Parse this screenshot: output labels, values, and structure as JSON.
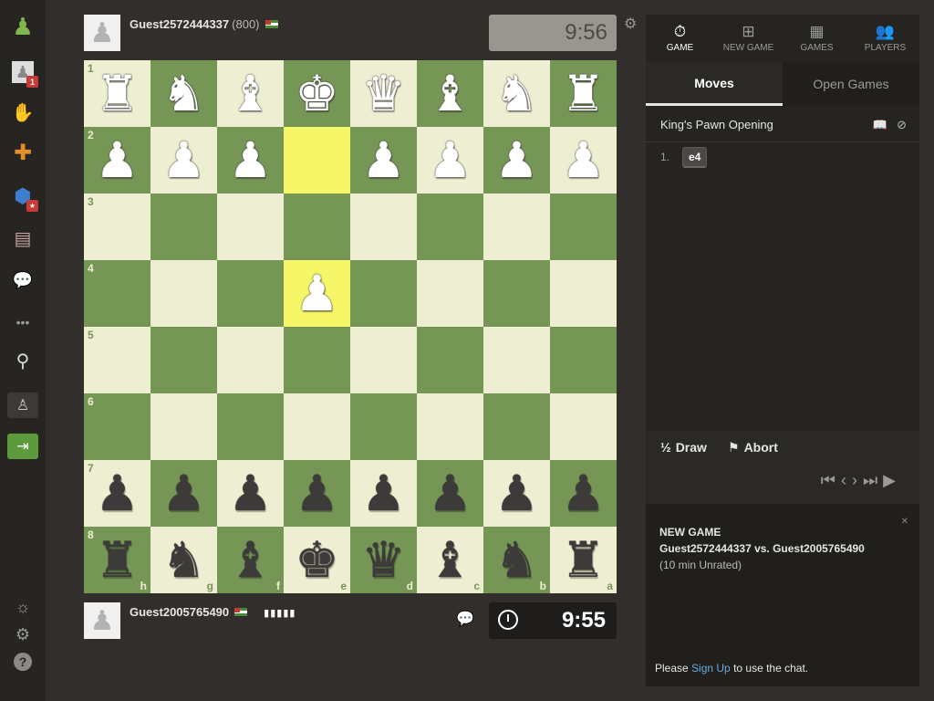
{
  "sidebar": {
    "items": [
      {
        "name": "chess-pawn-logo-icon",
        "glyph": "♟"
      },
      {
        "name": "profile-avatar-icon",
        "glyph": "♟",
        "badge": "1"
      },
      {
        "name": "puzzle-hand-icon",
        "glyph": "✋"
      },
      {
        "name": "puzzle-piece-icon",
        "glyph": "✚"
      },
      {
        "name": "learn-cap-icon",
        "glyph": "⬢",
        "badge": "★"
      },
      {
        "name": "news-icon",
        "glyph": "▤"
      },
      {
        "name": "community-chat-icon",
        "glyph": "💬"
      },
      {
        "name": "more-dots-icon",
        "glyph": "•••"
      },
      {
        "name": "search-icon",
        "glyph": "⚲"
      },
      {
        "name": "add-friend-icon",
        "glyph": "♙"
      },
      {
        "name": "login-icon",
        "glyph": "⇥"
      },
      {
        "name": "theme-toggle-icon",
        "glyph": "☼"
      },
      {
        "name": "settings-icon",
        "glyph": "⚙"
      },
      {
        "name": "help-icon",
        "glyph": "?"
      }
    ]
  },
  "top_player": {
    "name": "Guest2572444337",
    "rating": "(800)",
    "clock": "9:56"
  },
  "bottom_player": {
    "name": "Guest2005765490",
    "clock": "9:55",
    "bars": "▮▮▮▮▮"
  },
  "board": {
    "ranks": [
      "1",
      "2",
      "3",
      "4",
      "5",
      "6",
      "7",
      "8"
    ],
    "files": [
      "h",
      "g",
      "f",
      "e",
      "d",
      "c",
      "b",
      "a"
    ],
    "rows": [
      [
        "wr",
        "wn",
        "wb",
        "wk",
        "wq",
        "wb",
        "wn",
        "wr"
      ],
      [
        "wp",
        "wp",
        "wp",
        "",
        "wp",
        "wp",
        "wp",
        "wp"
      ],
      [
        "",
        "",
        "",
        "",
        "",
        "",
        "",
        ""
      ],
      [
        "",
        "",
        "",
        "wp",
        "",
        "",
        "",
        ""
      ],
      [
        "",
        "",
        "",
        "",
        "",
        "",
        "",
        ""
      ],
      [
        "",
        "",
        "",
        "",
        "",
        "",
        "",
        ""
      ],
      [
        "bp",
        "bp",
        "bp",
        "bp",
        "bp",
        "bp",
        "bp",
        "bp"
      ],
      [
        "br",
        "bn",
        "bb",
        "bk",
        "bq",
        "bb",
        "bn",
        "br"
      ]
    ],
    "highlighted": [
      [
        1,
        3
      ],
      [
        3,
        3
      ]
    ]
  },
  "panel": {
    "nav": [
      {
        "label": "GAME",
        "glyph": "⏱",
        "icon": "stopwatch-icon",
        "active": true
      },
      {
        "label": "NEW GAME",
        "glyph": "⊞",
        "icon": "plus-square-icon",
        "active": false
      },
      {
        "label": "GAMES",
        "glyph": "▦",
        "icon": "checkerboard-icon",
        "active": false
      },
      {
        "label": "PLAYERS",
        "glyph": "👥",
        "icon": "players-icon",
        "active": false
      }
    ],
    "tabs": {
      "moves": "Moves",
      "open_games": "Open Games"
    },
    "opening": "King's Pawn Opening",
    "moves": [
      {
        "num": "1.",
        "white": "e4"
      }
    ],
    "draw_label": "Draw",
    "draw_glyph": "½",
    "abort_label": "Abort",
    "new_game": {
      "title": "NEW GAME",
      "players": "Guest2572444337 vs. Guest2005765490",
      "type": "(10 min Unrated)"
    },
    "chat": {
      "before": "Please ",
      "link": "Sign Up",
      "after": " to use the chat."
    }
  },
  "colors": {
    "board_light": "#eeeed2",
    "board_dark": "#769656",
    "highlight": "#f6f669",
    "link": "#65a9e0"
  }
}
